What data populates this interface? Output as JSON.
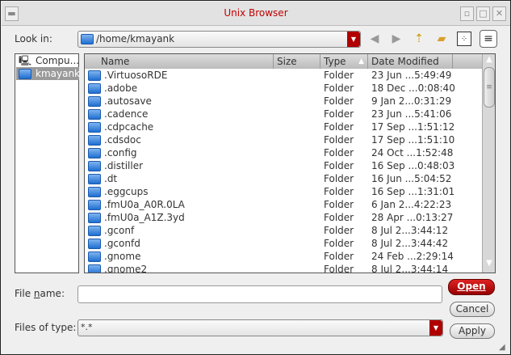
{
  "window": {
    "title": "Unix Browser"
  },
  "lookin": {
    "label": "Look in:",
    "path": "/home/kmayank"
  },
  "places": [
    {
      "label": "Compu..."
    },
    {
      "label": "kmayank"
    }
  ],
  "columns": [
    "Name",
    "Size",
    "Type",
    "Date Modified"
  ],
  "files": [
    {
      "name": ".VirtuosoRDE",
      "type": "Folder",
      "date": "23 Jun ...5:49:49"
    },
    {
      "name": ".adobe",
      "type": "Folder",
      "date": "18 Dec ...0:08:40"
    },
    {
      "name": ".autosave",
      "type": "Folder",
      "date": "9 Jan 2...0:31:29"
    },
    {
      "name": ".cadence",
      "type": "Folder",
      "date": "23 Jun ...5:41:06"
    },
    {
      "name": ".cdpcache",
      "type": "Folder",
      "date": "17 Sep ...1:51:12"
    },
    {
      "name": ".cdsdoc",
      "type": "Folder",
      "date": "17 Sep ...1:51:10"
    },
    {
      "name": ".config",
      "type": "Folder",
      "date": "24 Oct ...1:52:48"
    },
    {
      "name": ".distiller",
      "type": "Folder",
      "date": "16 Sep ...0:48:03"
    },
    {
      "name": ".dt",
      "type": "Folder",
      "date": "16 Jun ...5:04:52"
    },
    {
      "name": ".eggcups",
      "type": "Folder",
      "date": "16 Sep ...1:31:01"
    },
    {
      "name": ".fmU0a_A0R.0LA",
      "type": "Folder",
      "date": "6 Jan 2...4:22:23"
    },
    {
      "name": ".fmU0a_A1Z.3yd",
      "type": "Folder",
      "date": "28 Apr ...0:13:27"
    },
    {
      "name": ".gconf",
      "type": "Folder",
      "date": "8 Jul 2...3:44:12"
    },
    {
      "name": ".gconfd",
      "type": "Folder",
      "date": "8 Jul 2...3:44:42"
    },
    {
      "name": ".gnome",
      "type": "Folder",
      "date": "24 Feb ...2:29:14"
    },
    {
      "name": ".gnome2",
      "type": "Folder",
      "date": "8 Jul 2...3:44:14"
    }
  ],
  "filename": {
    "label_pre": "File ",
    "label_u": "n",
    "label_post": "ame:",
    "value": ""
  },
  "filetype": {
    "label": "Files of type:",
    "value": "*.*"
  },
  "buttons": {
    "open": "Open",
    "cancel": "Cancel",
    "apply": "Apply"
  },
  "colors": {
    "accent": "#b00000"
  }
}
